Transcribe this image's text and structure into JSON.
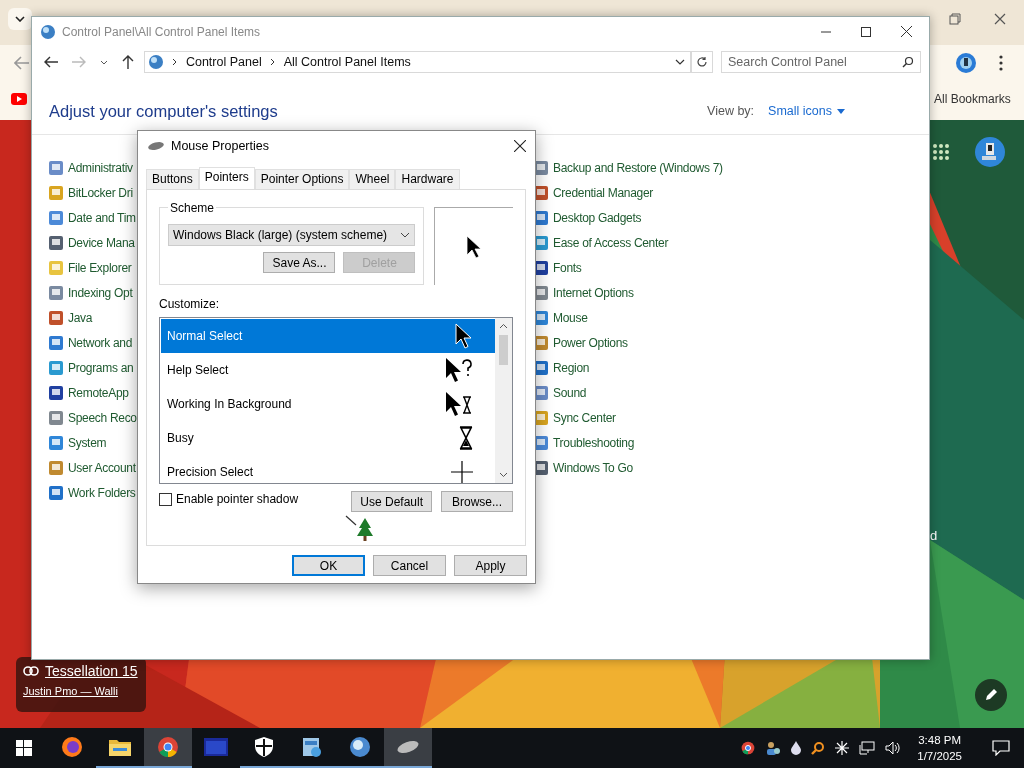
{
  "browser": {
    "bookmarks_label": "All Bookmarks"
  },
  "wallpaper": {
    "caption_title": "Tessellation 15",
    "caption_credit": "Justin Pmo — Walli",
    "partial_text": "d"
  },
  "control_panel": {
    "title": "Control Panel\\All Control Panel Items",
    "breadcrumb": [
      "Control Panel",
      "All Control Panel Items"
    ],
    "search": {
      "placeholder": "Search Control Panel"
    },
    "heading": "Adjust your computer's settings",
    "view_by_label": "View by:",
    "view_by_value": "Small icons",
    "items_left": [
      "Administrativ",
      "BitLocker Dri",
      "Date and Tim",
      "Device Mana",
      "File Explorer",
      "Indexing Opt",
      "Java",
      "Network and",
      "Programs an",
      "RemoteApp",
      "Speech Reco",
      "System",
      "User Account",
      "Work Folders"
    ],
    "items_right": [
      "Backup and Restore (Windows 7)",
      "Credential Manager",
      "Desktop Gadgets",
      "Ease of Access Center",
      "Fonts",
      "Internet Options",
      "Mouse",
      "Power Options",
      "Region",
      "Sound",
      "Sync Center",
      "Troubleshooting",
      "Windows To Go"
    ]
  },
  "dialog": {
    "title": "Mouse Properties",
    "tabs": [
      {
        "label": "Buttons",
        "selected": false
      },
      {
        "label": "Pointers",
        "selected": true
      },
      {
        "label": "Pointer Options",
        "selected": false
      },
      {
        "label": "Wheel",
        "selected": false
      },
      {
        "label": "Hardware",
        "selected": false
      }
    ],
    "scheme_label": "Scheme",
    "scheme_value": "Windows Black (large) (system scheme)",
    "scheme_buttons": [
      {
        "label": "Save As...",
        "disabled": false
      },
      {
        "label": "Delete",
        "disabled": true
      }
    ],
    "customize_label": "Customize:",
    "pointers": [
      {
        "name": "Normal Select",
        "selected": true,
        "kind": "arrow"
      },
      {
        "name": "Help Select",
        "selected": false,
        "kind": "help"
      },
      {
        "name": "Working In Background",
        "selected": false,
        "kind": "working"
      },
      {
        "name": "Busy",
        "selected": false,
        "kind": "busy"
      },
      {
        "name": "Precision Select",
        "selected": false,
        "kind": "cross"
      }
    ],
    "shadow": {
      "label": "Enable pointer shadow",
      "checked": false
    },
    "pointer_buttons": [
      "Use Default",
      "Browse..."
    ],
    "buttons": [
      {
        "label": "OK",
        "default": true
      },
      {
        "label": "Cancel",
        "default": false
      },
      {
        "label": "Apply",
        "default": false
      }
    ]
  },
  "taskbar": {
    "apps": [
      {
        "kind": "firefox",
        "running": false,
        "active": false
      },
      {
        "kind": "folder",
        "running": true,
        "active": false
      },
      {
        "kind": "chrome",
        "running": true,
        "active": true
      },
      {
        "kind": "window",
        "running": false,
        "active": false
      },
      {
        "kind": "shield",
        "running": true,
        "active": false
      },
      {
        "kind": "control-panel",
        "running": true,
        "active": false
      },
      {
        "kind": "globe",
        "running": true,
        "active": false
      },
      {
        "kind": "mouse",
        "running": true,
        "active": true
      }
    ],
    "time": "3:48 PM",
    "date": "1/7/2025"
  }
}
